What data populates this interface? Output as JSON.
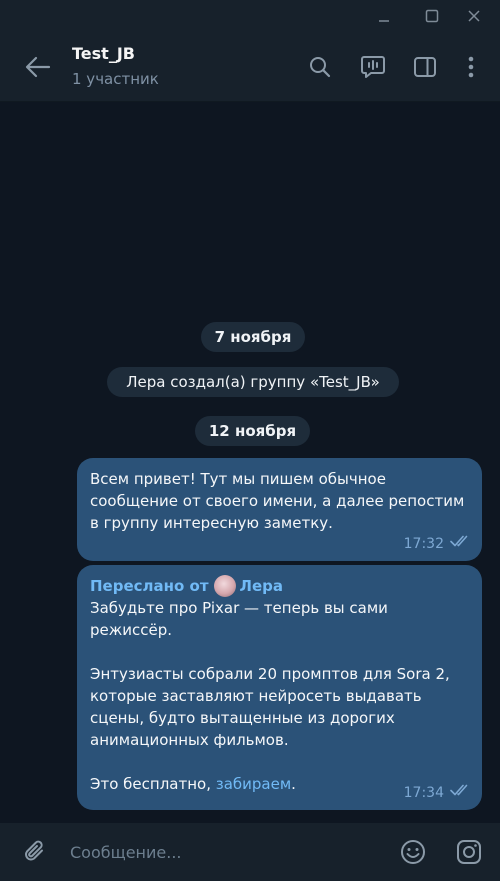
{
  "window": {
    "minimize_icon": "minimize-icon",
    "maximize_icon": "maximize-icon",
    "close_icon": "close-icon"
  },
  "header": {
    "title": "Test_JB",
    "subtitle": "1 участник",
    "icons": [
      "back-arrow-icon",
      "search-icon",
      "voice-chat-icon",
      "sidebar-toggle-icon",
      "more-vertical-icon"
    ]
  },
  "chat": {
    "date_1": "7 ноября",
    "service_message": "Лера создал(а) группу «Test_JB»",
    "date_2": "12 ноября",
    "messages": [
      {
        "text": "Всем привет! Тут мы пишем обычное сообщение от своего имени, а далее репостим в группу интересную заметку.",
        "time": "17:32",
        "status": "read"
      },
      {
        "forwarded_label": "Переслано от",
        "forwarded_from": "Лера",
        "text": "Забудьте про Pixar — теперь вы сами режиссёр.\n\nЭнтузиасты собрали 20 промптов для Sora 2, которые заставляют нейросеть выдавать сцены, будто вытащенные из дорогих анимационных фильмов.\n\nЭто бесплатно, ",
        "link_text": "забираем",
        "text_end": ".",
        "time": "17:34",
        "status": "read"
      }
    ]
  },
  "composer": {
    "placeholder": "Сообщение...",
    "icons": [
      "paperclip-icon",
      "emoji-icon",
      "camera-icon"
    ]
  },
  "colors": {
    "background": "#0e1621",
    "panel": "#17212b",
    "outgoing_bubble": "#2b5278",
    "accent": "#71baf6",
    "service_pill": "#1e2c3a"
  }
}
